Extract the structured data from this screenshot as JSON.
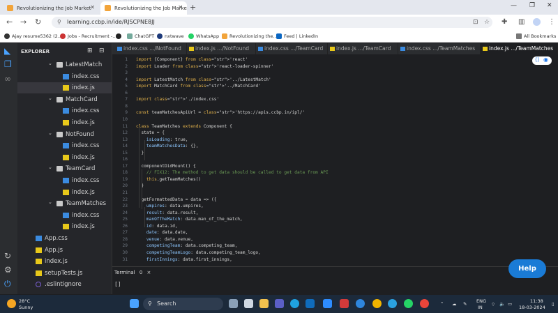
{
  "browser": {
    "tabs": [
      {
        "title": "Revolutionizing the Job Market"
      },
      {
        "title": "Revolutionizing the Job Market"
      }
    ],
    "url": "learning.ccbp.in/ide/RJSCPNE8JJ",
    "new_tab": "+",
    "bookmarks": [
      {
        "label": "Ajay resume5362 (2..."
      },
      {
        "label": "Jobs - Recruitment -..."
      },
      {
        "label": ""
      },
      {
        "label": "ChatGPT"
      },
      {
        "label": "nxtwave"
      },
      {
        "label": "WhatsApp"
      },
      {
        "label": "Revolutionizing the..."
      },
      {
        "label": "Feed | LinkedIn"
      }
    ],
    "all_bookmarks": "All Bookmarks"
  },
  "explorer": {
    "title": "EXPLORER",
    "items": [
      {
        "label": "LatestMatch",
        "kind": "folder"
      },
      {
        "label": "index.css",
        "kind": "css"
      },
      {
        "label": "index.js",
        "kind": "js"
      },
      {
        "label": "MatchCard",
        "kind": "folder"
      },
      {
        "label": "index.css",
        "kind": "css"
      },
      {
        "label": "index.js",
        "kind": "js"
      },
      {
        "label": "NotFound",
        "kind": "folder"
      },
      {
        "label": "index.css",
        "kind": "css"
      },
      {
        "label": "index.js",
        "kind": "js"
      },
      {
        "label": "TeamCard",
        "kind": "folder"
      },
      {
        "label": "index.css",
        "kind": "css"
      },
      {
        "label": "index.js",
        "kind": "js"
      },
      {
        "label": "TeamMatches",
        "kind": "folder"
      },
      {
        "label": "index.css",
        "kind": "css"
      },
      {
        "label": "index.js",
        "kind": "js"
      },
      {
        "label": "App.css",
        "kind": "css"
      },
      {
        "label": "App.js",
        "kind": "js"
      },
      {
        "label": "index.js",
        "kind": "js"
      },
      {
        "label": "setupTests.js",
        "kind": "js"
      },
      {
        "label": ".eslintignore",
        "kind": "eslint"
      }
    ]
  },
  "editor_tabs": [
    {
      "label": "index.css .../NotFound"
    },
    {
      "label": "index.js .../NotFound"
    },
    {
      "label": "index.css .../TeamCard"
    },
    {
      "label": "index.js .../TeamCard"
    },
    {
      "label": "index.css .../TeamMatches"
    },
    {
      "label": "index.js .../TeamMatches"
    }
  ],
  "code_lines": [
    {
      "n": "1",
      "t": "import {Component} from 'react'"
    },
    {
      "n": "2",
      "t": "import Loader from 'react-loader-spinner'"
    },
    {
      "n": "3",
      "t": ""
    },
    {
      "n": "4",
      "t": "import LatestMatch from '../LatestMatch'"
    },
    {
      "n": "5",
      "t": "import MatchCard from '../MatchCard'"
    },
    {
      "n": "6",
      "t": ""
    },
    {
      "n": "7",
      "t": "import './index.css'"
    },
    {
      "n": "8",
      "t": ""
    },
    {
      "n": "9",
      "t": "const teamMatchesApiUrl = 'https://apis.ccbp.in/ipl/'"
    },
    {
      "n": "10",
      "t": ""
    },
    {
      "n": "11",
      "t": "class TeamMatches extends Component {"
    },
    {
      "n": "12",
      "t": "  state = {"
    },
    {
      "n": "13",
      "t": "    isLoading: true,"
    },
    {
      "n": "14",
      "t": "    teamMatchesData: {},"
    },
    {
      "n": "15",
      "t": "  }"
    },
    {
      "n": "16",
      "t": ""
    },
    {
      "n": "17",
      "t": "  componentDidMount() {"
    },
    {
      "n": "18",
      "t": "    // FIX12: The method to get data should be called to get data from API"
    },
    {
      "n": "19",
      "t": "    this.getTeamMatches()"
    },
    {
      "n": "20",
      "t": "  }"
    },
    {
      "n": "21",
      "t": ""
    },
    {
      "n": "22",
      "t": "  getFormattedData = data => ({"
    },
    {
      "n": "23",
      "t": "    umpires: data.umpires,"
    },
    {
      "n": "24",
      "t": "    result: data.result,"
    },
    {
      "n": "25",
      "t": "    manOfTheMatch: data.man_of_the_match,"
    },
    {
      "n": "26",
      "t": "    id: data.id,"
    },
    {
      "n": "27",
      "t": "    date: data.date,"
    },
    {
      "n": "28",
      "t": "    venue: data.venue,"
    },
    {
      "n": "29",
      "t": "    competingTeam: data.competing_team,"
    },
    {
      "n": "30",
      "t": "    competingTeamLogo: data.competing_team_logo,"
    },
    {
      "n": "31",
      "t": "    firstInnings: data.first_innings,"
    }
  ],
  "terminal": {
    "title": "Terminal",
    "count": "0",
    "close": "×",
    "prompt": "[]"
  },
  "help_label": "Help",
  "taskbar": {
    "weather_temp": "28°C",
    "weather_text": "Sunny",
    "search_label": "Search",
    "lang_top": "ENG",
    "lang_bottom": "IN",
    "time": "11:38",
    "date": "18-03-2024"
  }
}
